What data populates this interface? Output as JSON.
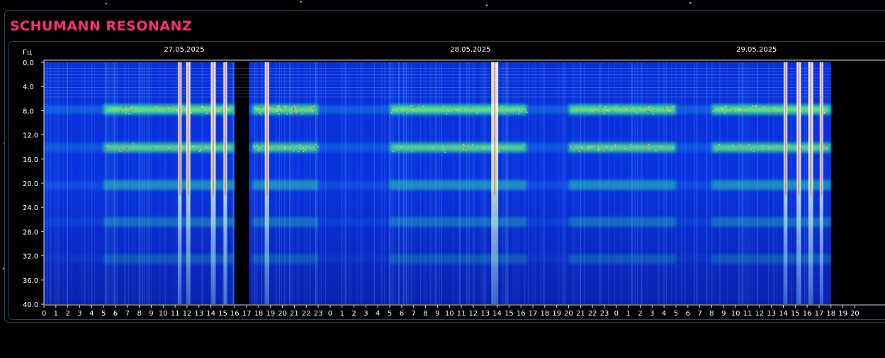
{
  "header": {
    "title": "SCHUMANN RESONANZ"
  },
  "chart_data": {
    "type": "heatmap",
    "title": "",
    "ylabel": "Гц",
    "xlabel": "",
    "ylim": [
      0,
      40
    ],
    "y_ticks": [
      "0.0",
      "4.0",
      "8.0",
      "12.0",
      "16.0",
      "20.0",
      "24.0",
      "28.0",
      "32.0",
      "36.0",
      "40.0"
    ],
    "y_values": [
      0,
      4,
      8,
      12,
      16,
      20,
      24,
      28,
      32,
      36,
      40
    ],
    "x_ticks": [
      "0",
      "1",
      "2",
      "3",
      "4",
      "5",
      "6",
      "7",
      "8",
      "9",
      "10",
      "11",
      "12",
      "13",
      "14",
      "15",
      "16",
      "17",
      "18",
      "19",
      "20",
      "21",
      "22",
      "23",
      "0",
      "1",
      "2",
      "3",
      "4",
      "5",
      "6",
      "7",
      "8",
      "9",
      "10",
      "11",
      "12",
      "13",
      "14",
      "15",
      "16",
      "17",
      "18",
      "19",
      "20",
      "21",
      "22",
      "23",
      "0",
      "1",
      "2",
      "3",
      "4",
      "5",
      "6",
      "7",
      "8",
      "9",
      "10",
      "11",
      "12",
      "13",
      "14",
      "15",
      "16",
      "17",
      "18",
      "19",
      "20"
    ],
    "dates": [
      {
        "label": "27.05.2025",
        "hour_index": 12
      },
      {
        "label": "28.05.2025",
        "hour_index": 36
      },
      {
        "label": "29.05.2025",
        "hour_index": 60
      }
    ],
    "data_end_hour_index": 66,
    "gap_hours": [
      16,
      17.2
    ],
    "frequency_bands_hz": [
      7.8,
      14.1,
      20.3,
      26.4,
      32.5
    ],
    "strong_band_hours": [
      {
        "from": 5,
        "to": 16
      },
      {
        "from": 17.5,
        "to": 23
      },
      {
        "from": 29,
        "to": 40.5
      },
      {
        "from": 44,
        "to": 53
      },
      {
        "from": 56,
        "to": 66
      }
    ],
    "bright_spikes_hours": [
      11.4,
      12.1,
      14.2,
      15.2,
      18.7,
      37.8,
      62.2,
      63.3,
      64.3,
      65.2
    ],
    "colors": {
      "background_low": "#0a1fa8",
      "background_high": "#0a35e6",
      "band": "#2ee0a0",
      "band_core": "#d8ff30",
      "spike": "#ffffff",
      "gap": "#000000",
      "axis_text": "#ffffff"
    }
  }
}
